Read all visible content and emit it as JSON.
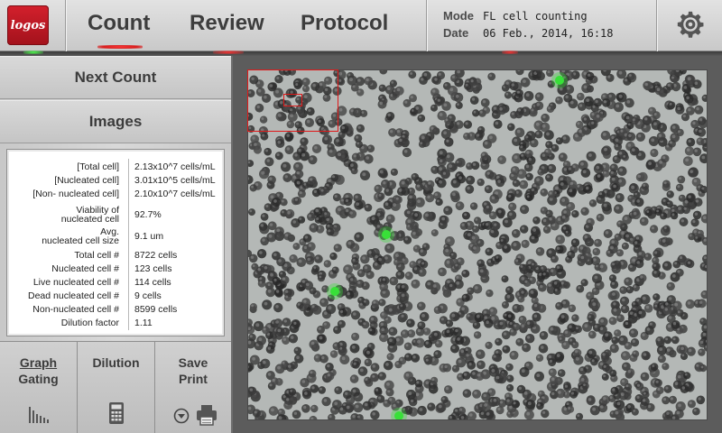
{
  "header": {
    "logo_text": "logos",
    "tabs": [
      {
        "label": "Count",
        "active": true
      },
      {
        "label": "Review",
        "active": false
      },
      {
        "label": "Protocol",
        "active": false
      }
    ],
    "mode_label": "Mode",
    "mode_value": "FL cell counting",
    "date_label": "Date",
    "date_value": "06 Feb., 2014, 16:18",
    "settings_icon": "gear-icon"
  },
  "sidebar": {
    "next_count": "Next Count",
    "images": "Images"
  },
  "results": [
    {
      "label": "[Total cell]",
      "value": "2.13x10^7 cells/mL"
    },
    {
      "label": "[Nucleated cell]",
      "value": "3.01x10^5 cells/mL"
    },
    {
      "label": "[Non- nucleated cell]",
      "value": "2.10x10^7 cells/mL"
    },
    {
      "label": "Viability of\nnucleated cell",
      "value": "92.7%"
    },
    {
      "label": "Avg.\nnucleated cell size",
      "value": "9.1 um"
    },
    {
      "label": "Total cell #",
      "value": "8722 cells"
    },
    {
      "label": "Nucleated cell #",
      "value": "123 cells"
    },
    {
      "label": "Live nucleated cell #",
      "value": "114 cells"
    },
    {
      "label": "Dead  nucleated cell #",
      "value": "9 cells"
    },
    {
      "label": "Non-nucleated cell #",
      "value": "8599 cells"
    },
    {
      "label": "Dilution factor",
      "value": "1.11"
    }
  ],
  "actions": {
    "graph": "Graph",
    "gating": "Gating",
    "dilution": "Dilution",
    "save": "Save",
    "print": "Print"
  },
  "colors": {
    "accent_red": "#d81c1c",
    "fluorescent_green": "#38e038",
    "logo_red": "#c41a24"
  }
}
